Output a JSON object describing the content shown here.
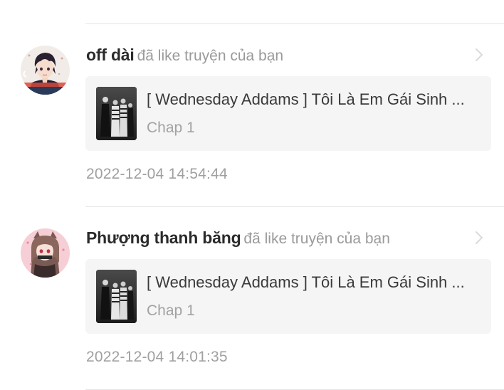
{
  "notifications": [
    {
      "username": "off dài",
      "action": "đã like truyện của bạn",
      "story_title": "[ Wednesday Addams ] Tôi Là Em Gái Sinh ...",
      "chapter": "Chap 1",
      "timestamp": "2022-12-04 14:54:44",
      "avatar_icon": "anime-boy-avatar",
      "thumbnail_icon": "addams-family-cover"
    },
    {
      "username": "Phượng thanh băng",
      "action": "đã like truyện của bạn",
      "story_title": "[ Wednesday Addams ] Tôi Là Em Gái Sinh ...",
      "chapter": "Chap 1",
      "timestamp": "2022-12-04 14:01:35",
      "avatar_icon": "anime-girl-avatar",
      "thumbnail_icon": "addams-family-cover"
    }
  ],
  "colors": {
    "username": "#2b2b2b",
    "secondary_text": "#9a9a9a",
    "card_background": "#f5f5f6",
    "divider": "#e4e4e4"
  }
}
